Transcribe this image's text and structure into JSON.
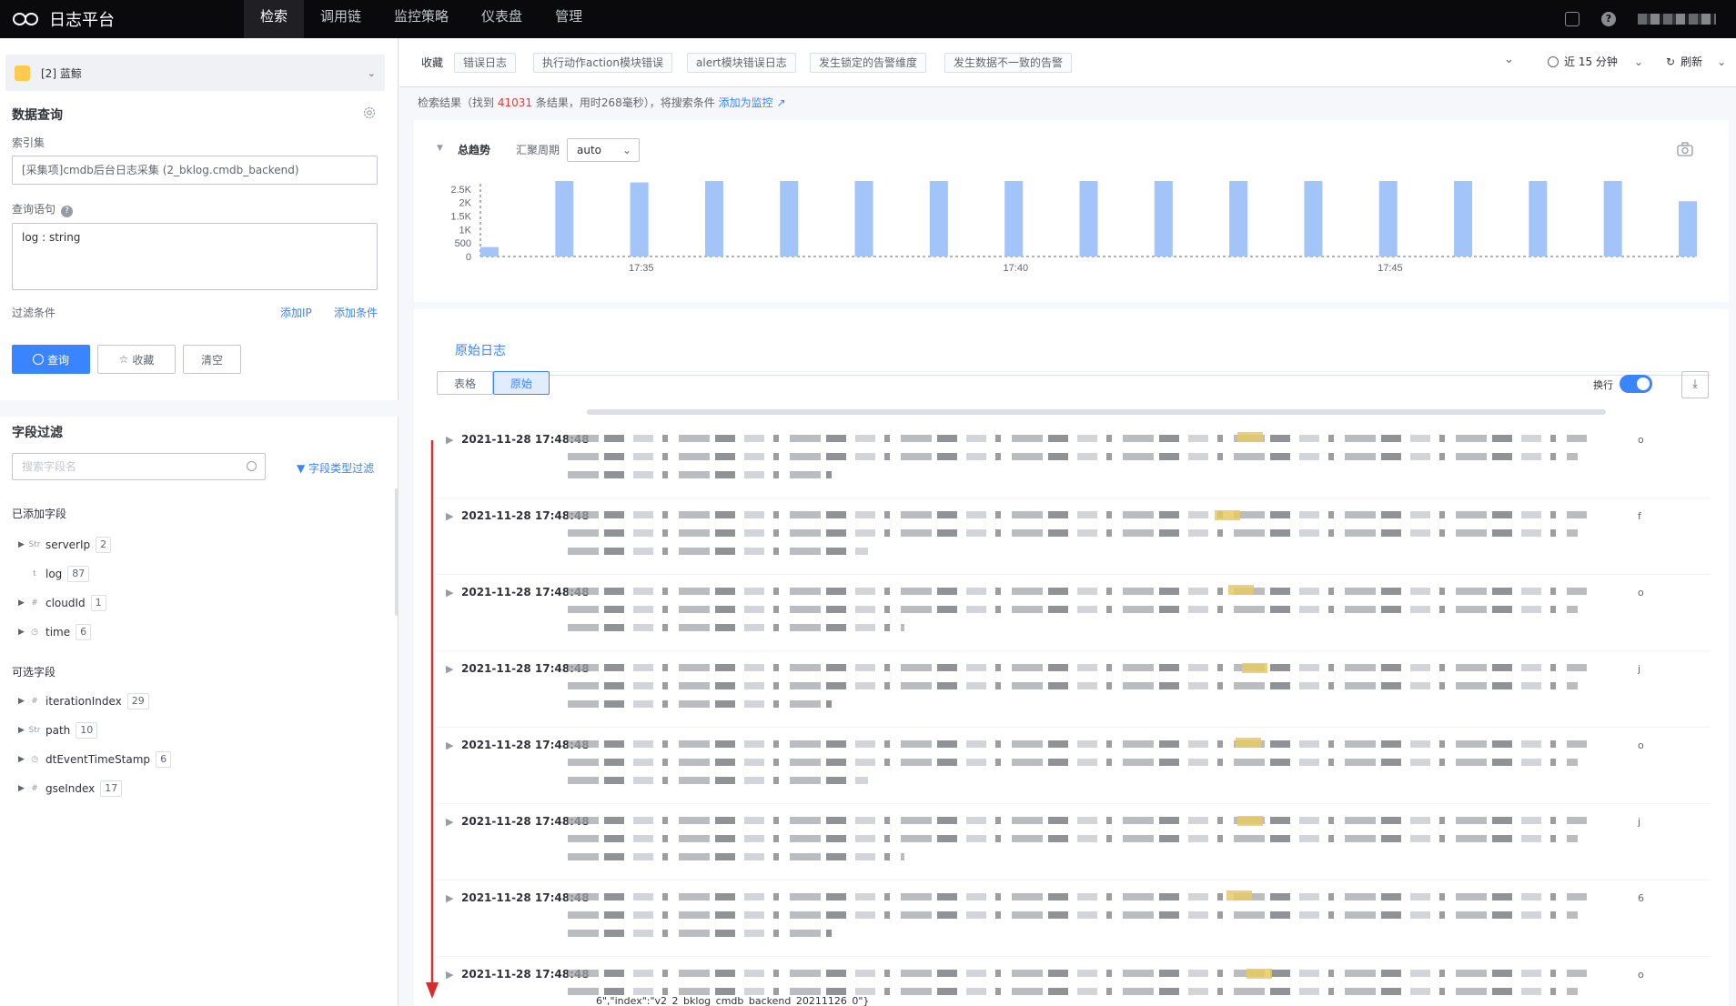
{
  "app": {
    "name": "日志平台"
  },
  "nav": {
    "tabs": [
      "检索",
      "调用链",
      "监控策略",
      "仪表盘",
      "管理"
    ],
    "active": 0
  },
  "biz": {
    "label": "[2] 蓝鲸"
  },
  "query": {
    "section_title": "数据查询",
    "index_label": "索引集",
    "index_value": "[采集项]cmdb后台日志采集 (2_bklog.cmdb_backend)",
    "stmt_label": "查询语句",
    "stmt_value": "log : string",
    "filter_label": "过滤条件",
    "add_ip": "添加IP",
    "add_cond": "添加条件",
    "btn_query": "查询",
    "btn_fav": "收藏",
    "btn_clear": "清空"
  },
  "fields": {
    "section_title": "字段过滤",
    "search_placeholder": "搜索字段名",
    "type_filter": "字段类型过滤",
    "added_label": "已添加字段",
    "added": [
      {
        "name": "serverIp",
        "type": "Str",
        "count": "2",
        "expand": true
      },
      {
        "name": "log",
        "type": "t",
        "count": "87",
        "expand": false
      },
      {
        "name": "cloudId",
        "type": "#",
        "count": "1",
        "expand": true
      },
      {
        "name": "time",
        "type": "◷",
        "count": "6",
        "expand": true
      }
    ],
    "optional_label": "可选字段",
    "optional": [
      {
        "name": "iterationIndex",
        "type": "#",
        "count": "29",
        "expand": true
      },
      {
        "name": "path",
        "type": "Str",
        "count": "10",
        "expand": true
      },
      {
        "name": "dtEventTimeStamp",
        "type": "◷",
        "count": "6",
        "expand": true
      },
      {
        "name": "gseIndex",
        "type": "#",
        "count": "17",
        "expand": true
      }
    ]
  },
  "favorites": {
    "label": "收藏",
    "items": [
      "错误日志",
      "执行动作action模块错误",
      "alert模块错误日志",
      "发生锁定的告警维度",
      "发生数据不一致的告警"
    ],
    "time_range": "近 15 分钟",
    "refresh": "刷新"
  },
  "summary": {
    "prefix": "检索结果（找到",
    "count": "41031",
    "middle": "条结果，用时268毫秒），将搜索条件",
    "add_monitor": "添加为监控"
  },
  "trend": {
    "title": "总趋势",
    "period_label": "汇聚周期",
    "period_value": "auto"
  },
  "chart_data": {
    "type": "bar",
    "x_ticks": [
      "17:35",
      "17:40",
      "17:45"
    ],
    "y_ticks": [
      "2.5K",
      "2K",
      "1.5K",
      "1K",
      "500",
      "0"
    ],
    "ylim": [
      0,
      2700
    ],
    "values": [
      350,
      2800,
      2750,
      2800,
      2800,
      2800,
      2800,
      2800,
      2800,
      2800,
      2800,
      2800,
      2800,
      2800,
      2800,
      2800,
      2050
    ],
    "color": "#a3c4f8"
  },
  "logs": {
    "tab": "原始日志",
    "view_table": "表格",
    "view_raw": "原始",
    "wrap_label": "换行",
    "rows": [
      {
        "time": "2021-11-28 17:48:48",
        "tail": "o"
      },
      {
        "time": "2021-11-28 17:48:48",
        "tail": "f"
      },
      {
        "time": "2021-11-28 17:48:48",
        "tail": "o"
      },
      {
        "time": "2021-11-28 17:48:48",
        "tail": "j"
      },
      {
        "time": "2021-11-28 17:48:48",
        "tail": "o"
      },
      {
        "time": "2021-11-28 17:48:48",
        "tail": "j"
      },
      {
        "time": "2021-11-28 17:48:48",
        "tail": "6"
      },
      {
        "time": "2021-11-28 17:48:48",
        "tail": "o"
      }
    ],
    "last_line": "6\",\"index\":\"v2_2_bklog_cmdb_backend_20211126_0\"}"
  }
}
